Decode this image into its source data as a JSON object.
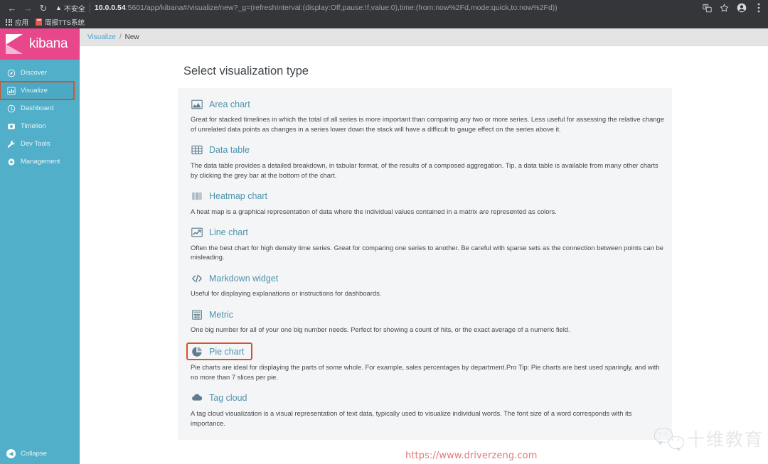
{
  "browser": {
    "back_icon": "back-arrow-icon",
    "forward_icon": "forward-arrow-icon",
    "reload_icon": "reload-icon",
    "security_label": "不安全",
    "url_host": "10.0.0.54",
    "url_rest": ":5601/app/kibana#/visualize/new?_g=(refreshInterval:(display:Off,pause:!f,value:0),time:(from:now%2Fd,mode:quick,to:now%2Fd))",
    "toolbar_icons": [
      "translate-icon",
      "bookmark-star-icon",
      "profile-avatar-icon",
      "chrome-menu-icon"
    ],
    "bookmarks": [
      {
        "label": "应用",
        "icon": "apps-grid-icon"
      },
      {
        "label": "周报TTS系统",
        "icon": "bookmark-favicon"
      }
    ]
  },
  "sidebar": {
    "logo_text": "kibana",
    "items": [
      {
        "label": "Discover",
        "icon": "compass-icon",
        "active": false,
        "highlighted": false
      },
      {
        "label": "Visualize",
        "icon": "bar-chart-icon",
        "active": true,
        "highlighted": true
      },
      {
        "label": "Dashboard",
        "icon": "dashboard-icon",
        "active": false,
        "highlighted": false
      },
      {
        "label": "Timelion",
        "icon": "timelion-icon",
        "active": false,
        "highlighted": false
      },
      {
        "label": "Dev Tools",
        "icon": "wrench-icon",
        "active": false,
        "highlighted": false
      },
      {
        "label": "Management",
        "icon": "gear-icon",
        "active": false,
        "highlighted": false
      }
    ],
    "collapse_label": "Collapse",
    "collapse_icon": "chevron-left-circle-icon",
    "bg_color": "#52afc9",
    "logo_color": "#e8488b",
    "highlight_color": "#d9512c"
  },
  "breadcrumb": {
    "parent": "Visualize",
    "separator": "/",
    "current": "New"
  },
  "main": {
    "page_title": "Select visualization type",
    "vis_types": [
      {
        "name": "Area chart",
        "icon": "area-chart-icon",
        "selected": false,
        "description": "Great for stacked timelines in which the total of all series is more important than comparing any two or more series. Less useful for assessing the relative change of unrelated data points as changes in a series lower down the stack will have a difficult to gauge effect on the series above it."
      },
      {
        "name": "Data table",
        "icon": "table-grid-icon",
        "selected": false,
        "description": "The data table provides a detailed breakdown, in tabular format, of the results of a composed aggregation. Tip, a data table is available from many other charts by clicking the grey bar at the bottom of the chart."
      },
      {
        "name": "Heatmap chart",
        "icon": "heatmap-bars-icon",
        "selected": false,
        "description": "A heat map is a graphical representation of data where the individual values contained in a matrix are represented as colors."
      },
      {
        "name": "Line chart",
        "icon": "line-chart-icon",
        "selected": false,
        "description": "Often the best chart for high density time series. Great for comparing one series to another. Be careful with sparse sets as the connection between points can be misleading."
      },
      {
        "name": "Markdown widget",
        "icon": "code-brackets-icon",
        "selected": false,
        "description": "Useful for displaying explanations or instructions for dashboards."
      },
      {
        "name": "Metric",
        "icon": "calculator-icon",
        "selected": false,
        "description": "One big number for all of your one big number needs. Perfect for showing a count of hits, or the exact average of a numeric field."
      },
      {
        "name": "Pie chart",
        "icon": "pie-chart-icon",
        "selected": true,
        "description": "Pie charts are ideal for displaying the parts of some whole. For example, sales percentages by department.Pro Tip: Pie charts are best used sparingly, and with no more than 7 slices per pie."
      },
      {
        "name": "Tag cloud",
        "icon": "cloud-icon",
        "selected": false,
        "description": "A tag cloud visualization is a visual representation of text data, typically used to visualize individual words. The font size of a word corresponds with its importance."
      }
    ]
  },
  "watermarks": {
    "wechat_text": "十维教育",
    "wechat_icon": "wechat-logo-icon",
    "site_url": "https://www.driverzeng.com"
  }
}
